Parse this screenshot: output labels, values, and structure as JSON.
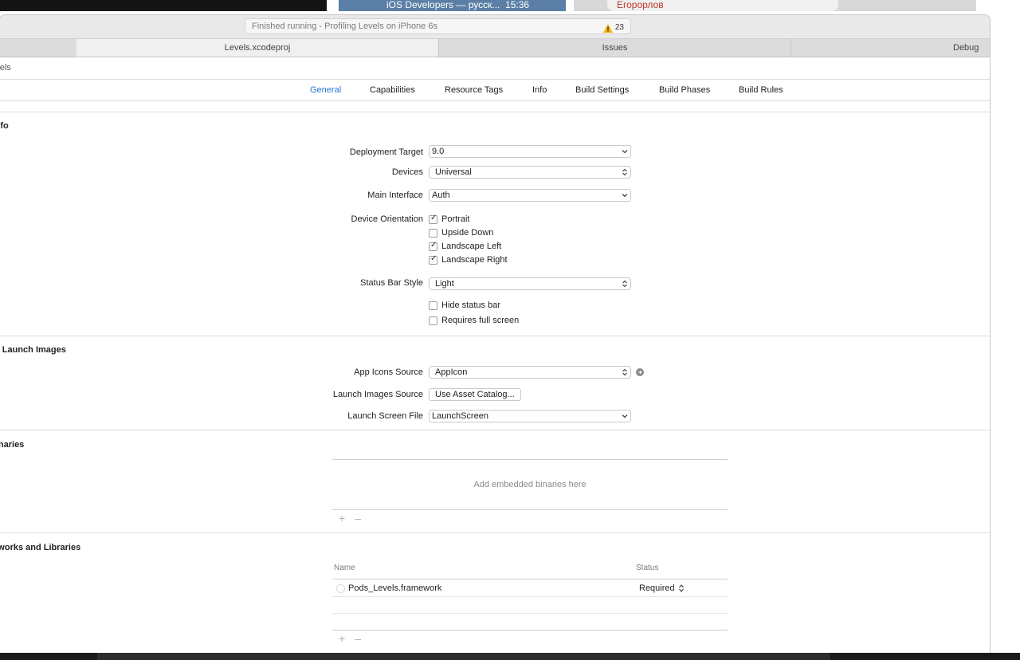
{
  "background": {
    "chat_title": "iOS Developers — русск...",
    "chat_time": "15:36",
    "contact_name": "Егорорлов"
  },
  "toolbar": {
    "activity_text": "Finished running - Profiling Levels on iPhone 6s",
    "warning_count": "23"
  },
  "file_tabs": [
    {
      "label": "Levels.xcodeproj"
    },
    {
      "label": "Issues"
    },
    {
      "label": "Debug"
    }
  ],
  "jump_bar": {
    "project": "Levels"
  },
  "editor_tabs": [
    {
      "label": "General"
    },
    {
      "label": "Capabilities"
    },
    {
      "label": "Resource Tags"
    },
    {
      "label": "Info"
    },
    {
      "label": "Build Settings"
    },
    {
      "label": "Build Phases"
    },
    {
      "label": "Build Rules"
    }
  ],
  "sections": {
    "deployment_info": "ent Info",
    "app_icons": "s and Launch Images",
    "embedded": "ed Binaries",
    "frameworks": "rameworks and Libraries"
  },
  "deployment": {
    "target_label": "Deployment Target",
    "target_value": "9.0",
    "devices_label": "Devices",
    "devices_value": "Universal",
    "main_interface_label": "Main Interface",
    "main_interface_value": "Auth",
    "orientation_label": "Device Orientation",
    "orientations": [
      {
        "label": "Portrait",
        "checked": true
      },
      {
        "label": "Upside Down",
        "checked": false
      },
      {
        "label": "Landscape Left",
        "checked": true
      },
      {
        "label": "Landscape Right",
        "checked": true
      }
    ],
    "status_bar_label": "Status Bar Style",
    "status_bar_value": "Light",
    "hide_status_bar": "Hide status bar",
    "requires_full_screen": "Requires full screen"
  },
  "app_icons": {
    "icons_source_label": "App Icons Source",
    "icons_source_value": "AppIcon",
    "launch_images_label": "Launch Images Source",
    "launch_images_button": "Use Asset Catalog...",
    "launch_screen_label": "Launch Screen File",
    "launch_screen_value": "LaunchScreen"
  },
  "embedded": {
    "placeholder": "Add embedded binaries here"
  },
  "frameworks": {
    "col_name": "Name",
    "col_status": "Status",
    "rows": [
      {
        "name": "Pods_Levels.framework",
        "status": "Required"
      }
    ]
  },
  "controls": {
    "plus": "+",
    "minus": "–"
  }
}
